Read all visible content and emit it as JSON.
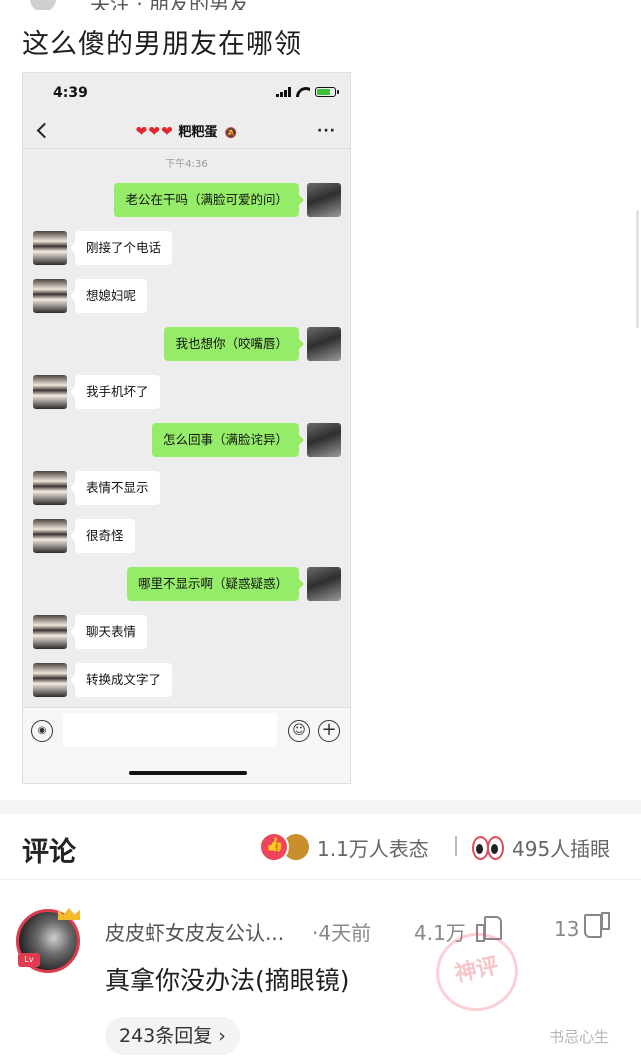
{
  "post": {
    "top_text": "关注  ·  朋友的男友",
    "title": "这么傻的男朋友在哪领"
  },
  "phone": {
    "time": "4:39",
    "chat_title": "粑粑蛋",
    "hearts": [
      "❤",
      "❤",
      "❤"
    ],
    "timestamp": "下午4:36",
    "messages": [
      {
        "side": "right",
        "text": "老公在干吗（满脸可爱的问）"
      },
      {
        "side": "left",
        "text": "刚接了个电话"
      },
      {
        "side": "left",
        "text": "想媳妇呢"
      },
      {
        "side": "right",
        "text": "我也想你（咬嘴唇）"
      },
      {
        "side": "left",
        "text": "我手机坏了"
      },
      {
        "side": "right",
        "text": "怎么回事（满脸诧异）"
      },
      {
        "side": "left",
        "text": "表情不显示"
      },
      {
        "side": "left",
        "text": "很奇怪"
      },
      {
        "side": "right",
        "text": "哪里不显示啊（疑惑疑惑）"
      },
      {
        "side": "left",
        "text": "聊天表情"
      },
      {
        "side": "left",
        "text": "转换成文字了"
      }
    ],
    "icons": {
      "back": "chevron-left-icon",
      "more": "more-dots-icon",
      "voice": "voice-icon",
      "emoji": "emoji-icon",
      "plus": "plus-icon"
    }
  },
  "comments": {
    "title": "评论",
    "reactions_count": "1.1万人表态",
    "eyes_count": "495人插眼",
    "items": [
      {
        "user": "皮皮虾女皮友公认...",
        "time": "·4天前",
        "likes": "4.1万",
        "dislikes": "13",
        "text": "真拿你没办法(摘眼镜)",
        "replies": "243条回复",
        "badge": "神评",
        "level": "Lv"
      }
    ]
  },
  "watermark": "书忌心生",
  "colors": {
    "wechat_green": "#95ec69",
    "accent_red": "#e03b4e",
    "chat_bg": "#ededed"
  }
}
